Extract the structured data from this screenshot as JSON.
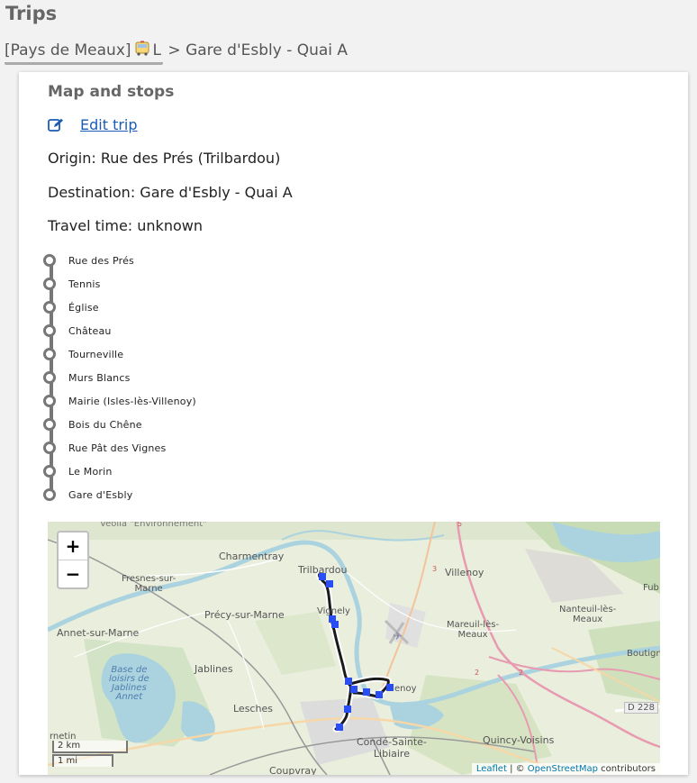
{
  "page": {
    "title": "Trips"
  },
  "breadcrumb": {
    "network": "[Pays de Meaux]",
    "line": "L",
    "separator": ">",
    "headsign": "Gare d'Esbly - Quai A"
  },
  "card": {
    "section_title": "Map and stops",
    "edit_label": "Edit trip",
    "origin": "Origin: Rue des Prés (Trilbardou)",
    "destination": "Destination: Gare d'Esbly - Quai A",
    "travel_time": "Travel time: unknown"
  },
  "stops": [
    "Rue des Prés",
    "Tennis",
    "Église",
    "Château",
    "Tourneville",
    "Murs Blancs",
    "Mairie (Isles-lès-Villenoy)",
    "Bois du Chêne",
    "Rue Pât des Vignes",
    "Le Morin",
    "Gare d'Esbly"
  ],
  "map": {
    "zoom_in": "+",
    "zoom_out": "−",
    "scale_km": "2 km",
    "scale_mi": "1 mi",
    "attribution_leaflet": "Leaflet",
    "attribution_sep": " | © ",
    "attribution_osm": "OpenStreetMap",
    "attribution_suffix": " contributors",
    "places": {
      "veolia": "Veolia \"Environnement\"",
      "charmentray": "Charmentray",
      "trilbardou": "Trilbardou",
      "villenoy": "Villenoy",
      "fresnes": "Fresnes-sur-\nMarne",
      "precy": "Précy-sur-Marne",
      "vignely": "Vignely",
      "nanteuil": "Nanteuil-lès-\nMeaux",
      "annet": "Annet-sur-Marne",
      "mareuil": "Mareuil-lès-\nMeaux",
      "jablines": "Jablines",
      "base": "Base de\nloisirs de\nJablines\nAnnet",
      "isles": "enoy",
      "boutigny": "Boutign",
      "fub": "Fub",
      "lesches": "Lesches",
      "conde": "Condé-Sainte-\nLibiaire",
      "quincy": "Quincy-Voisins",
      "coupvray": "Coupvray",
      "d228": "D 228",
      "carnetin": "rnetin"
    }
  },
  "colors": {
    "link": "#1a5bb5",
    "stop_marker": "#2a4ef5",
    "route": "#1a1a1a"
  }
}
